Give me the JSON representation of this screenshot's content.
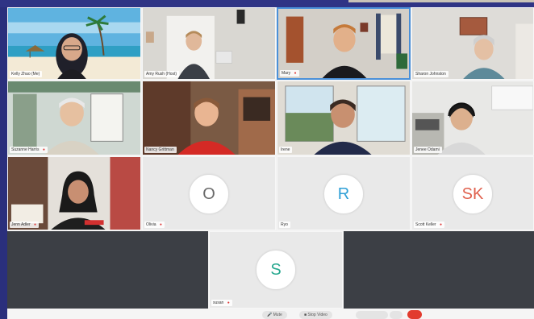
{
  "participants": [
    {
      "name": "Kelly Zhao",
      "suffix": "(Me)"
    },
    {
      "name": "Amy Rush",
      "suffix": "(Host)"
    },
    {
      "name": "Mary",
      "suffix": ""
    },
    {
      "name": "Sharon Johnston",
      "suffix": ""
    },
    {
      "name": "Suzanne Harris",
      "suffix": ""
    },
    {
      "name": "Nancy Grittman",
      "suffix": ""
    },
    {
      "name": "Irene",
      "suffix": ""
    },
    {
      "name": "Jenee Odami",
      "suffix": ""
    },
    {
      "name": "Jenn Adler",
      "suffix": ""
    },
    {
      "name": "Olivia",
      "suffix": "",
      "initials": "O",
      "color": "#6a6a6a"
    },
    {
      "name": "Ryo",
      "suffix": "",
      "initials": "R",
      "color": "#2e9fd6"
    },
    {
      "name": "Scott Keller",
      "suffix": "",
      "initials": "SK",
      "color": "#e0614e"
    },
    {
      "name": "susan",
      "suffix": "",
      "initials": "S",
      "color": "#27a88f"
    }
  ],
  "toolbar": {
    "mute_label": "Mute",
    "stop_video_label": "Stop Video"
  },
  "colors": {
    "active_border": "#4a90d9",
    "end_button": "#e23b2e"
  }
}
